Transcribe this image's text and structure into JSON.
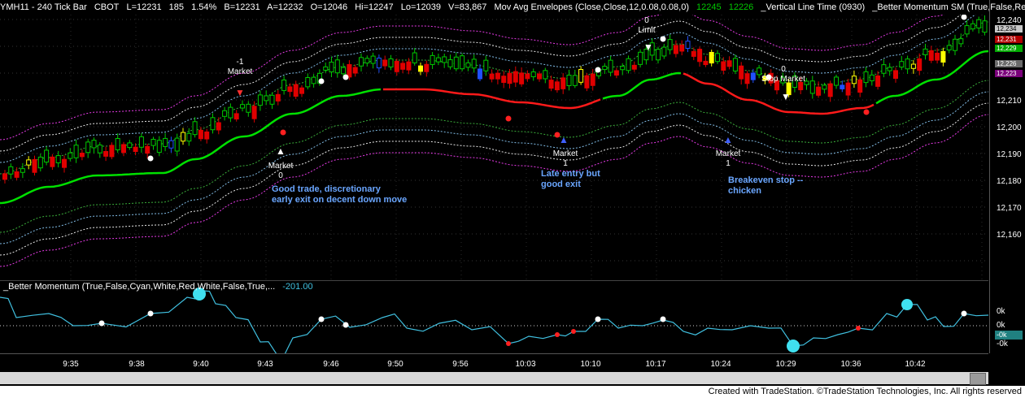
{
  "header": {
    "symbol": "YMH11 - 240 Tick Bar",
    "exchange": "CBOT",
    "last": "L=12231",
    "change": "185",
    "change_pct": "1.54%",
    "bid": "B=12231",
    "ask": "A=12232",
    "open": "O=12046",
    "high": "Hi=12247",
    "low": "Lo=12039",
    "volume": "V=83,867",
    "study1": "Mov Avg Envelopes (Close,Close,12,0.08,0.08,0)",
    "study1_v1": "12245",
    "study1_v2": "12226",
    "study2": "_Vertical Line Time (0930)",
    "study3": "_Better Momentum SM (True,False,Red ..."
  },
  "price_axis": {
    "ticks": [
      "12,240",
      "12,230",
      "12,220",
      "12,210",
      "12,200",
      "12,190",
      "12,180",
      "12,170",
      "12,160"
    ],
    "tags": [
      {
        "text": "12,234",
        "color": "#c8c8c8"
      },
      {
        "text": "12,231",
        "color": "#b00000"
      },
      {
        "text": "12,229",
        "color": "#00aa00"
      },
      {
        "text": "12,226",
        "color": "#6a6a6a"
      },
      {
        "text": "12,223",
        "color": "#7a007a"
      }
    ]
  },
  "osc": {
    "header": "_Better Momentum (True,False,Cyan,White,Red,White,False,True,...",
    "value": "-201.00",
    "ticks": [
      "0k",
      "0k",
      "-0k",
      "-0k"
    ]
  },
  "time_axis": {
    "ticks": [
      "9:35",
      "9:38",
      "9:40",
      "9:43",
      "9:46",
      "9:50",
      "9:56",
      "10:03",
      "10:10",
      "10:17",
      "10:24",
      "10:29",
      "10:36",
      "10:42"
    ]
  },
  "annotations": {
    "market_neg1_top": "-1",
    "market_neg1_bottom": "Market",
    "market0_label": "Market",
    "market0_num": "0",
    "note1_line1": "Good trade, discretionary",
    "note1_line2": "early exit on decent down move",
    "limit_num": "0",
    "limit_label": "Limit",
    "market1a_label": "Market",
    "market1a_num": "1",
    "note2_line1": "Late entry but",
    "note2_line2": "good exit",
    "stop_num": "0",
    "stop_label": "Stop Market",
    "market1b_label": "Market",
    "market1b_num": "1",
    "note3_line1": "Breakeven stop --",
    "note3_line2": "chicken"
  },
  "footer": {
    "text": "Created with TradeStation. ©TradeStation Technologies, Inc. All rights reserved"
  },
  "colors": {
    "bull": "#00c800",
    "bear": "#e00000",
    "ma_up": "#00e000",
    "ma_down": "#ff1a1a",
    "envelope": "#ff40ff",
    "osc_line": "#40c0e0",
    "note": "#6aa6ff"
  }
}
